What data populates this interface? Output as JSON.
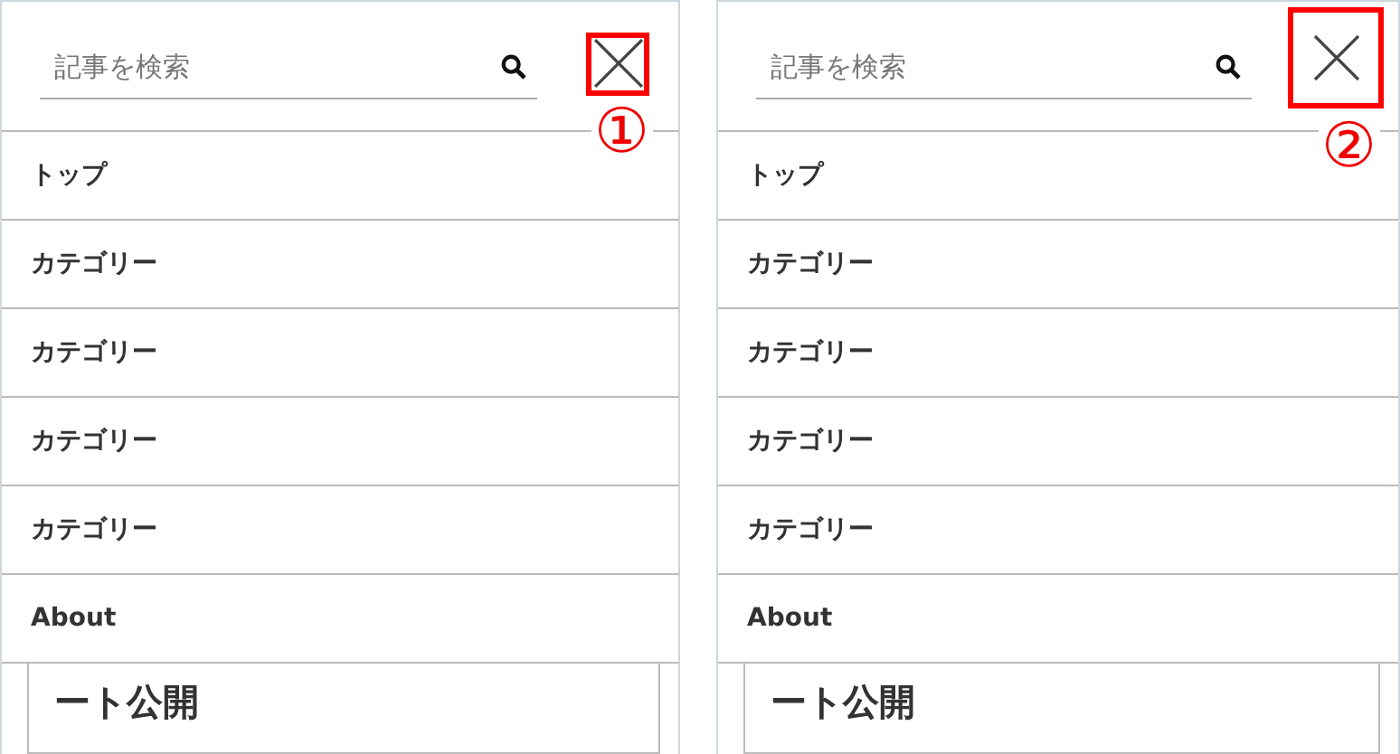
{
  "panels": [
    {
      "search": {
        "placeholder": "記事を検索"
      },
      "close_button": {
        "kind": "small"
      },
      "annotation": "①",
      "menu": [
        "トップ",
        "カテゴリー",
        "カテゴリー",
        "カテゴリー",
        "カテゴリー",
        "About"
      ],
      "article_title": "ート公開"
    },
    {
      "search": {
        "placeholder": "記事を検索"
      },
      "close_button": {
        "kind": "large"
      },
      "annotation": "②",
      "menu": [
        "トップ",
        "カテゴリー",
        "カテゴリー",
        "カテゴリー",
        "カテゴリー",
        "About"
      ],
      "article_title": "ート公開"
    }
  ]
}
